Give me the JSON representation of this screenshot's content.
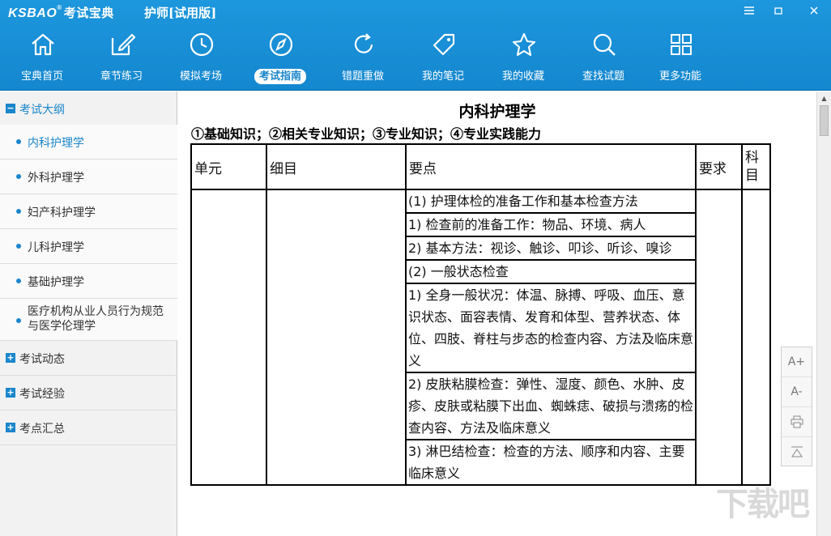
{
  "titlebar": {
    "logo": "KSBAO",
    "logo_mark": "®",
    "logo_cn": "考试宝典",
    "app_title": "护师[试用版]",
    "menu_icon": "menu-lines-icon",
    "minimize_icon": "minimize-icon",
    "close_icon": "close-icon"
  },
  "nav": [
    {
      "label": "宝典首页",
      "icon": "home-icon"
    },
    {
      "label": "章节练习",
      "icon": "edit-icon"
    },
    {
      "label": "模拟考场",
      "icon": "clock-icon"
    },
    {
      "label": "考试指南",
      "icon": "compass-icon",
      "active": true
    },
    {
      "label": "错题重做",
      "icon": "refresh-icon"
    },
    {
      "label": "我的笔记",
      "icon": "tag-icon"
    },
    {
      "label": "我的收藏",
      "icon": "star-icon"
    },
    {
      "label": "查找试题",
      "icon": "search-icon"
    },
    {
      "label": "更多功能",
      "icon": "grid-icon"
    }
  ],
  "sidebar": {
    "group_main": {
      "label": "考试大纲",
      "toggle": "−"
    },
    "items": [
      {
        "label": "内科护理学",
        "active": true
      },
      {
        "label": "外科护理学"
      },
      {
        "label": "妇产科护理学"
      },
      {
        "label": "儿科护理学"
      },
      {
        "label": "基础护理学"
      },
      {
        "label": "医疗机构从业人员行为规范与医学伦理学"
      }
    ],
    "groups": [
      {
        "label": "考试动态",
        "toggle": "+"
      },
      {
        "label": "考试经验",
        "toggle": "+"
      },
      {
        "label": "考点汇总",
        "toggle": "+"
      }
    ]
  },
  "doc": {
    "title": "内科护理学",
    "subtitle": "①基础知识；②相关专业知识；③专业知识；④专业实践能力",
    "headers": {
      "unit": "单元",
      "detail": "细目",
      "points": "要点",
      "require": "要求",
      "subject": "科目"
    },
    "points": [
      "(1) 护理体检的准备工作和基本检查方法",
      "1) 检查前的准备工作：物品、环境、病人",
      "2) 基本方法：视诊、触诊、叩诊、听诊、嗅诊",
      "(2) 一般状态检查",
      "1) 全身一般状况：体温、脉搏、呼吸、血压、意识状态、面容表情、发育和体型、营养状态、体位、四肢、脊柱与步态的检查内容、方法及临床意义",
      "2) 皮肤粘膜检查：弹性、湿度、颜色、水肿、皮疹、皮肤或粘膜下出血、蜘蛛痣、破损与溃疡的检查内容、方法及临床意义",
      "3) 淋巴结检查：检查的方法、顺序和内容、主要临床意义"
    ]
  },
  "tools": {
    "font_up": "A+",
    "font_down": "A-"
  },
  "watermark": "下载吧"
}
